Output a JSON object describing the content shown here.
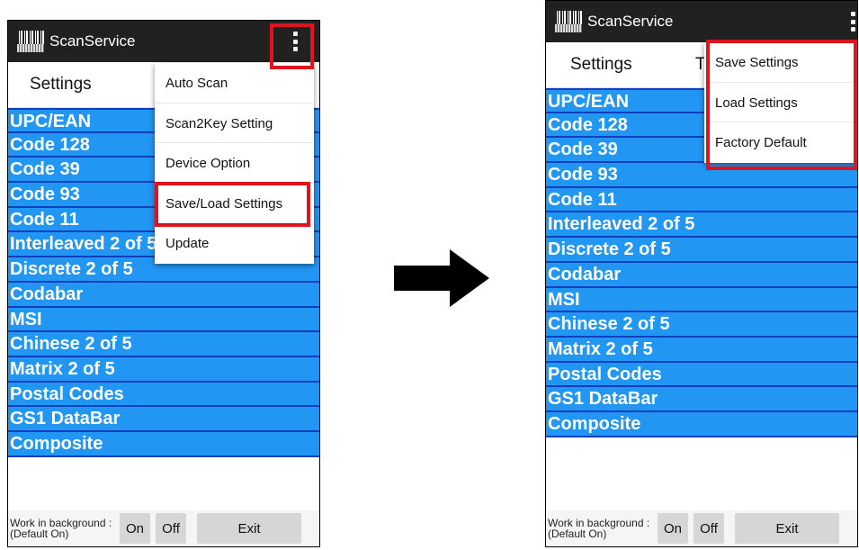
{
  "left_screen": {
    "app_title": "ScanService",
    "tab_label": "Settings",
    "tab_label_partial": "T",
    "menu_items": [
      "Auto Scan",
      "Scan2Key Setting",
      "Device Option",
      "Save/Load Settings",
      "Update"
    ],
    "highlighted_menu_item": "Save/Load Settings"
  },
  "right_screen": {
    "app_title": "ScanService",
    "tab_label": "Settings",
    "tab_label_partial": "T",
    "menu_items": [
      "Save Settings",
      "Load Settings",
      "Factory Default"
    ]
  },
  "symbologies": [
    "UPC/EAN",
    "Code 128",
    "Code 39",
    "Code 93",
    "Code 11",
    "Interleaved 2 of 5",
    "Discrete 2 of 5",
    "Codabar",
    "MSI",
    "Chinese 2 of 5",
    "Matrix 2 of 5",
    "Postal Codes",
    "GS1 DataBar",
    "Composite"
  ],
  "bottom_bar": {
    "background_label_line1": "Work in background :",
    "background_label_line2": "(Default On)",
    "on_label": "On",
    "off_label": "Off",
    "exit_label": "Exit"
  },
  "icons": {
    "app": "barcode-icon",
    "overflow": "more-vert-icon",
    "transition": "arrow-right-icon"
  },
  "colors": {
    "title_bar": "#212121",
    "row_background": "#2196f3",
    "row_divider": "#123fbf",
    "highlight": "#e0141e"
  }
}
